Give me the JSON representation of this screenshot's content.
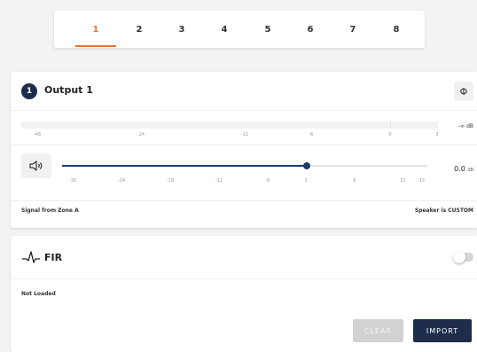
{
  "tabs": [
    "1",
    "2",
    "3",
    "4",
    "5",
    "6",
    "7",
    "8"
  ],
  "active_tab": "1",
  "output": {
    "badge": "1",
    "title": "Output 1",
    "phase_symbol": "Φ",
    "meter": {
      "labels": [
        "-48",
        "-24",
        "-12",
        "-6",
        "0",
        "3"
      ],
      "readout": "-∞ dB",
      "level_fraction": 0
    },
    "volume": {
      "tick_labels": [
        "-30",
        "-24",
        "-18",
        "-12",
        "-6",
        "3",
        "6",
        "12",
        "15"
      ],
      "value_text": "0.0",
      "unit": "dB",
      "slider_fraction": 0.67
    },
    "signal_source": "Signal from Zone A",
    "speaker_status": "Speaker is CUSTOM"
  },
  "fir": {
    "title": "FIR",
    "enabled": false,
    "status": "Not Loaded",
    "clear_label": "CLEAR",
    "import_label": "IMPORT"
  },
  "colors": {
    "accent": "#e8703a",
    "primary": "#1f2d4d",
    "slider": "#1f3a6a"
  },
  "icons": {
    "phase": "phase-icon",
    "speaker": "speaker-icon",
    "fir": "waveform-icon",
    "toggle": "toggle-icon"
  }
}
